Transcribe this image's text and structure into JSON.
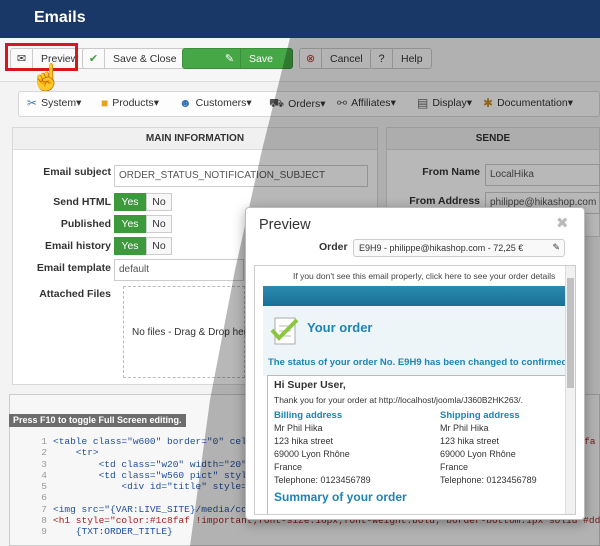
{
  "window": {
    "title": "Emails"
  },
  "toolbar": {
    "preview": "Preview",
    "save_close": "Save & Close",
    "save": "Save",
    "cancel": "Cancel",
    "help": "Help"
  },
  "menu": {
    "items": [
      {
        "label": "System",
        "icon": "wrench-icon"
      },
      {
        "label": "Products",
        "icon": "box-icon"
      },
      {
        "label": "Customers",
        "icon": "users-icon"
      },
      {
        "label": "Orders",
        "icon": "cart-icon"
      },
      {
        "label": "Affiliates",
        "icon": "affiliates-icon"
      },
      {
        "label": "Display",
        "icon": "display-icon"
      },
      {
        "label": "Documentation",
        "icon": "book-icon"
      }
    ]
  },
  "main_info": {
    "header": "MAIN INFORMATION",
    "email_subject_label": "Email subject",
    "email_subject_value": "ORDER_STATUS_NOTIFICATION_SUBJECT",
    "send_html_label": "Send HTML",
    "published_label": "Published",
    "email_history_label": "Email history",
    "email_template_label": "Email template",
    "email_template_value": "default",
    "attached_files_label": "Attached Files",
    "yes": "Yes",
    "no": "No",
    "dropzone_text": "No files - Drag & Drop her"
  },
  "sender": {
    "header": "SENDE",
    "from_name_label": "From Name",
    "from_name_value": "LocalHika",
    "from_address_label": "From Address",
    "from_address_value": "philippe@hikashop.com"
  },
  "editor": {
    "hint": "Press F10 to toggle Full Screen editing.",
    "lines": [
      {
        "n": "1",
        "code": "<table class=\"w600\" border=\"0\" cel"
      },
      {
        "n": "2",
        "code": "    <tr>"
      },
      {
        "n": "3",
        "code": "        <td class=\"w20\" width=\"20\""
      },
      {
        "n": "4",
        "code": "        <td class=\"w560 pict\" styl"
      },
      {
        "n": "5",
        "code": "            <div id=\"title\" style="
      },
      {
        "n": "6",
        "code": ""
      },
      {
        "n": "7",
        "code": "<img src=\"{VAR:LIVE_SITE}/media/co"
      },
      {
        "n": "8",
        "code": "<h1 style=\"color:#1c8faf !important;font-size:16px;font-weight:bold; border-bottom:1px solid #ddd; p"
      },
      {
        "n": "9",
        "code": "    {TXT:ORDER_TITLE}"
      }
    ],
    "right_fragment": "fa"
  },
  "preview_modal": {
    "title": "Preview",
    "order_label": "Order",
    "order_value": "E9H9 - philippe@hikashop.com - 72,25 €",
    "see_properly": "If you don't see this email properly, click here to see your order details",
    "your_order": "Your order",
    "status_msg": "The status of your order No. E9H9 has been changed to confirmed",
    "greeting": "Hi Super User,",
    "thanks": "Thank you for your order at http://localhost/joomla/J360B2HK263/.",
    "billing_title": "Billing address",
    "shipping_title": "Shipping address",
    "billing": [
      "Mr Phil Hika",
      "123 hika street",
      "69000 Lyon Rhône",
      "France",
      "Telephone: 0123456789"
    ],
    "shipping": [
      "Mr Phil Hika",
      "123 hika street",
      "69000 Lyon Rhône",
      "France",
      "Telephone: 0123456789"
    ],
    "summary": "Summary of your order"
  },
  "colors": {
    "topbar": "#1a3867",
    "highlight": "#d9161b",
    "save_green": "#45a745",
    "accent_blue": "#1e84b3"
  }
}
